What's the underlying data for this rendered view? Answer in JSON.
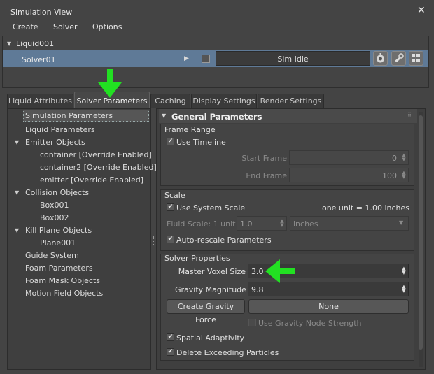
{
  "window": {
    "title": "Simulation View",
    "close_icon": "close-icon"
  },
  "menu": {
    "create": "Create",
    "solver": "Solver",
    "options": "Options"
  },
  "tree": {
    "liquid": "Liquid001",
    "solver": "Solver01",
    "status": "Sim Idle"
  },
  "tabs": [
    "Liquid Attributes",
    "Solver Parameters",
    "Caching",
    "Display Settings",
    "Render Settings"
  ],
  "left_list": [
    {
      "label": "Simulation Parameters",
      "selected": true
    },
    {
      "label": "Liquid Parameters"
    },
    {
      "label": "Emitter Objects"
    },
    {
      "label": "container [Override Enabled]"
    },
    {
      "label": "container2 [Override Enabled]"
    },
    {
      "label": "emitter [Override Enabled]"
    },
    {
      "label": "Collision Objects"
    },
    {
      "label": "Box001"
    },
    {
      "label": "Box002"
    },
    {
      "label": "Kill Plane Objects"
    },
    {
      "label": "Plane001"
    },
    {
      "label": "Guide System"
    },
    {
      "label": "Foam Parameters"
    },
    {
      "label": "Foam Mask Objects"
    },
    {
      "label": "Motion Field Objects"
    }
  ],
  "general": {
    "title": "General Parameters",
    "frame_range": {
      "title": "Frame Range",
      "use_timeline": "Use Timeline",
      "start_label": "Start Frame",
      "start_value": "0",
      "end_label": "End Frame",
      "end_value": "100"
    },
    "scale": {
      "title": "Scale",
      "use_system_scale": "Use System Scale",
      "unit_text": "one unit = 1.00 inches",
      "fluid_scale_label": "Fluid Scale: 1 unit =",
      "fluid_scale_value": "1.0",
      "units": "inches",
      "auto_rescale": "Auto-rescale Parameters"
    },
    "solver_props": {
      "title": "Solver Properties",
      "voxel_label": "Master Voxel Size",
      "voxel_value": "3.0",
      "gravity_label": "Gravity Magnitude",
      "gravity_value": "9.8",
      "create_gravity": "Create Gravity Force",
      "none": "None",
      "use_gravity_node": "Use Gravity Node Strength",
      "spatial": "Spatial Adaptivity",
      "delete_exceeding": "Delete Exceeding Particles"
    }
  },
  "colors": {
    "selection": "#5f7a97",
    "annotation_arrow": "#22e022"
  }
}
